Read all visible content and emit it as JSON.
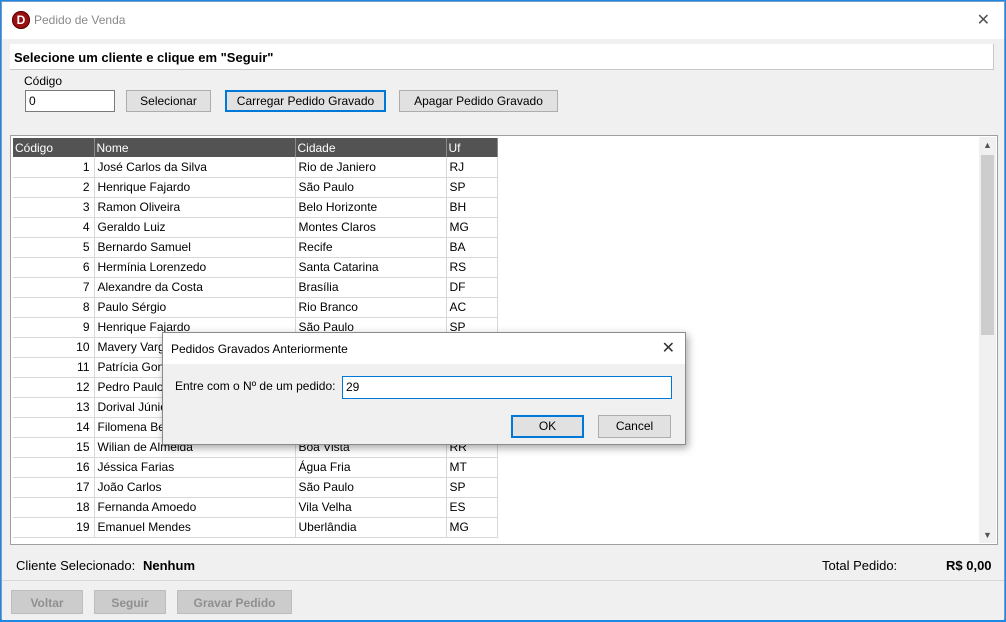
{
  "window": {
    "title": "Pedido de Venda",
    "app_icon_letter": "D",
    "close_glyph": "✕"
  },
  "header": {
    "instruction": "Selecione um cliente e clique em \"Seguir\""
  },
  "search": {
    "codigo_label": "Código",
    "codigo_value": "0",
    "selecionar_label": "Selecionar",
    "carregar_label": "Carregar Pedido Gravado",
    "apagar_label": "Apagar Pedido Gravado"
  },
  "grid": {
    "columns": [
      "Código",
      "Nome",
      "Cidade",
      "Uf"
    ],
    "rows": [
      [
        "1",
        "José Carlos da Silva",
        "Rio de Janiero",
        "RJ"
      ],
      [
        "2",
        "Henrique Fajardo",
        "São Paulo",
        "SP"
      ],
      [
        "3",
        "Ramon Oliveira",
        "Belo Horizonte",
        "BH"
      ],
      [
        "4",
        "Geraldo Luiz",
        "Montes Claros",
        "MG"
      ],
      [
        "5",
        "Bernardo Samuel",
        "Recife",
        "BA"
      ],
      [
        "6",
        "Hermínia Lorenzedo",
        "Santa Catarina",
        "RS"
      ],
      [
        "7",
        "Alexandre da Costa",
        "Brasília",
        "DF"
      ],
      [
        "8",
        "Paulo Sérgio",
        "Rio Branco",
        "AC"
      ],
      [
        "9",
        "Henrique Fajardo",
        "São Paulo",
        "SP"
      ],
      [
        "10",
        "Mavery Varg",
        "",
        ""
      ],
      [
        "11",
        "Patrícia Gonç",
        "",
        ""
      ],
      [
        "12",
        "Pedro Paulo",
        "",
        ""
      ],
      [
        "13",
        "Dorival Júnio",
        "",
        ""
      ],
      [
        "14",
        "Filomena Ber",
        "",
        ""
      ],
      [
        "15",
        "Wilian de Almeida",
        "Boa Vista",
        "RR"
      ],
      [
        "16",
        "Jéssica Farias",
        "Água Fria",
        "MT"
      ],
      [
        "17",
        "João Carlos",
        "São Paulo",
        "SP"
      ],
      [
        "18",
        "Fernanda Amoedo",
        "Vila Velha",
        "ES"
      ],
      [
        "19",
        "Emanuel Mendes",
        "Uberlândia",
        "MG"
      ]
    ]
  },
  "status": {
    "cliente_label": "Cliente Selecionado:",
    "cliente_value": "Nenhum",
    "total_label": "Total Pedido:",
    "total_value": "R$ 0,00"
  },
  "footer": {
    "voltar_label": "Voltar",
    "seguir_label": "Seguir",
    "gravar_label": "Gravar Pedido"
  },
  "dialog": {
    "title": "Pedidos Gravados Anteriormente",
    "prompt": "Entre com o Nº de um pedido:",
    "input_value": "29",
    "ok_label": "OK",
    "cancel_label": "Cancel",
    "close_glyph": "✕"
  }
}
